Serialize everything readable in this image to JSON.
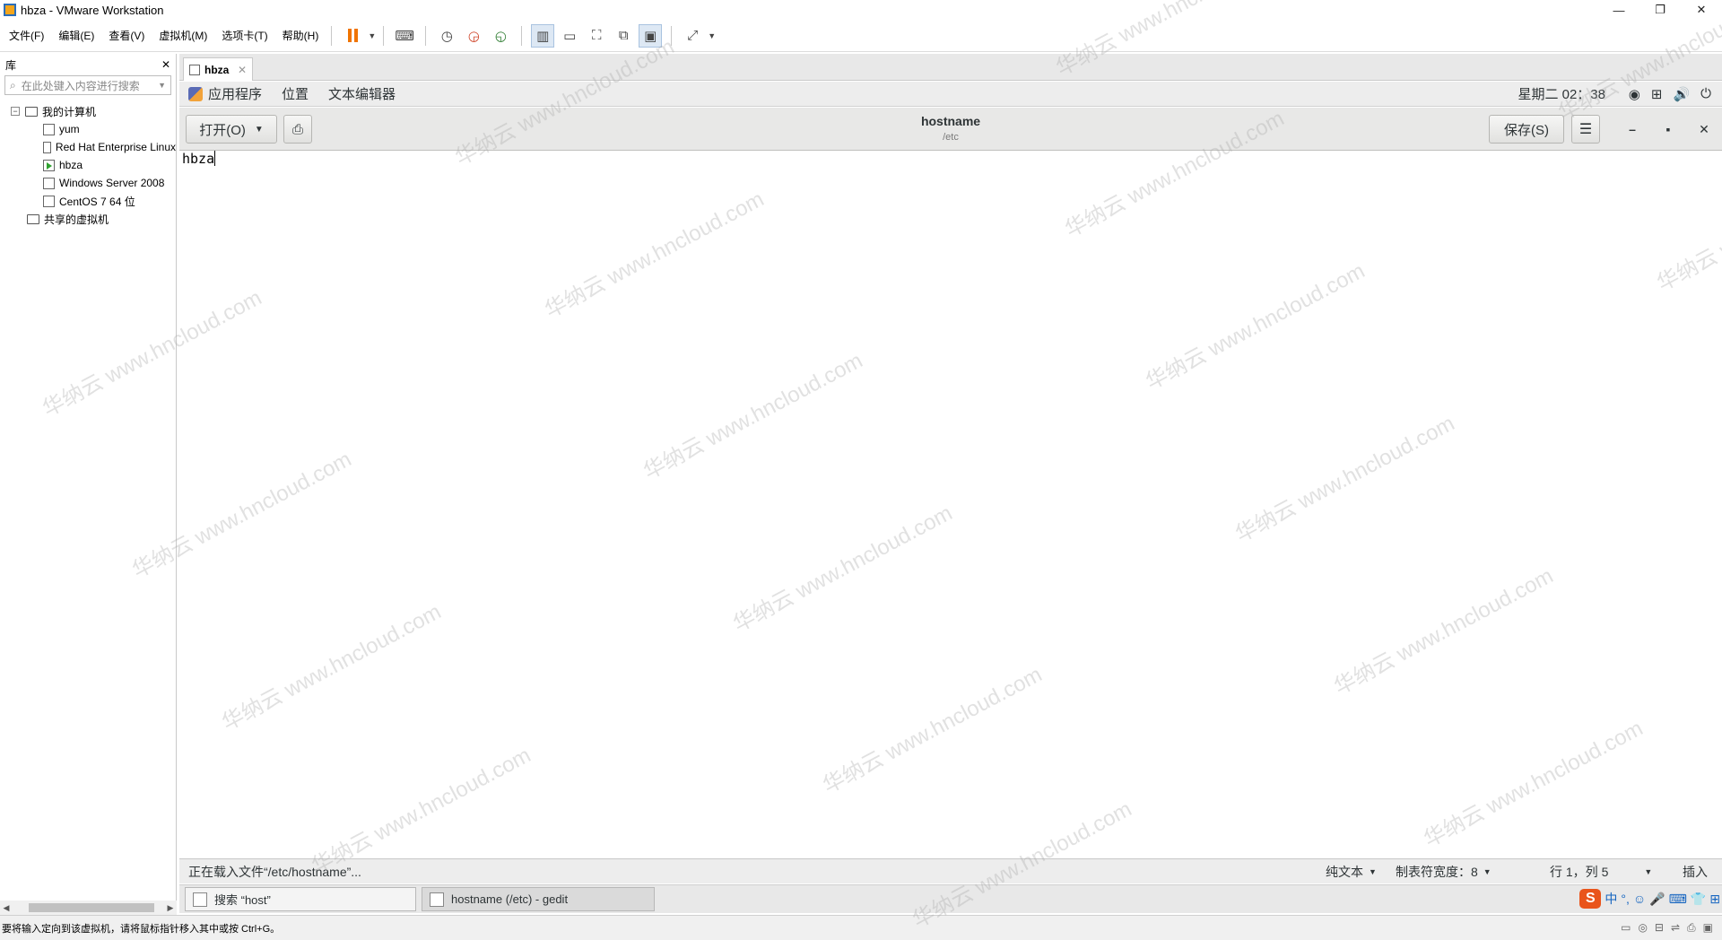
{
  "window": {
    "title": "hbza - VMware Workstation",
    "controls": [
      "—",
      "❐",
      "✕"
    ]
  },
  "menus": [
    "文件(F)",
    "编辑(E)",
    "查看(V)",
    "虚拟机(M)",
    "选项卡(T)",
    "帮助(H)"
  ],
  "library": {
    "title": "库",
    "search_placeholder": "在此处键入内容进行搜索",
    "tree": [
      {
        "label": "我的计算机",
        "level": 0,
        "kind": "computer"
      },
      {
        "label": "yum",
        "level": 1,
        "kind": "vm"
      },
      {
        "label": "Red Hat Enterprise Linux",
        "level": 1,
        "kind": "vm"
      },
      {
        "label": "hbza",
        "level": 1,
        "kind": "vm-running"
      },
      {
        "label": "Windows Server 2008",
        "level": 1,
        "kind": "vm"
      },
      {
        "label": "CentOS 7 64 位",
        "level": 1,
        "kind": "vm"
      },
      {
        "label": "共享的虚拟机",
        "level": 0,
        "kind": "shared"
      }
    ]
  },
  "vm_tab": {
    "label": "hbza"
  },
  "gnome_top": {
    "applications": "应用程序",
    "places": "位置",
    "app_name": "文本编辑器",
    "clock": "星期二 02：38"
  },
  "gedit": {
    "open_label": "打开(O)",
    "save_label": "保存(S)",
    "file_title": "hostname",
    "file_path": "/etc",
    "content": "hbza"
  },
  "gedit_status": {
    "message": "正在载入文件“/etc/hostname”...",
    "syntax": "纯文本",
    "tab_width": "制表符宽度：8",
    "position": "行 1，列 5",
    "mode": "插入"
  },
  "taskbar": {
    "items": [
      "搜索 “host”",
      "hostname (/etc) - gedit"
    ]
  },
  "vm_status": {
    "message": "要将输入定向到该虚拟机，请将鼠标指针移入其中或按 Ctrl+G。"
  },
  "watermark": "华纳云 www.hncloud.com",
  "colors": {
    "pause": "#f07400",
    "ime": "#e9541b"
  }
}
